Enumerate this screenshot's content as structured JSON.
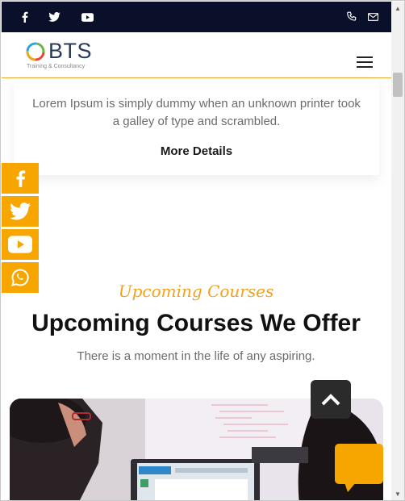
{
  "topbar": {
    "social_icons": [
      "facebook-icon",
      "twitter-icon",
      "youtube-icon"
    ],
    "contact_icons": [
      "phone-icon",
      "mail-icon"
    ],
    "bg_color": "#0a0f2a"
  },
  "header": {
    "logo_text": "BTS",
    "logo_subtitle": "Training & Consultancy",
    "menu_icon": "hamburger-icon",
    "accent_color": "#e8a92c"
  },
  "card": {
    "text": "Lorem Ipsum is simply dummy when an unknown printer took a galley of type and scrambled.",
    "link_label": "More Details"
  },
  "side_social": {
    "icons": [
      "facebook-icon",
      "twitter-icon",
      "youtube-icon",
      "whatsapp-icon"
    ],
    "color": "#f7a600"
  },
  "section": {
    "script_title": "Upcoming Courses",
    "title": "Upcoming Courses We Offer",
    "subtitle": "There is a moment in the life of any aspiring."
  },
  "floating": {
    "back_to_top_icon": "chevron-up-icon",
    "chat_icon": "chat-bubble-icon",
    "chat_color": "#f7a600"
  }
}
